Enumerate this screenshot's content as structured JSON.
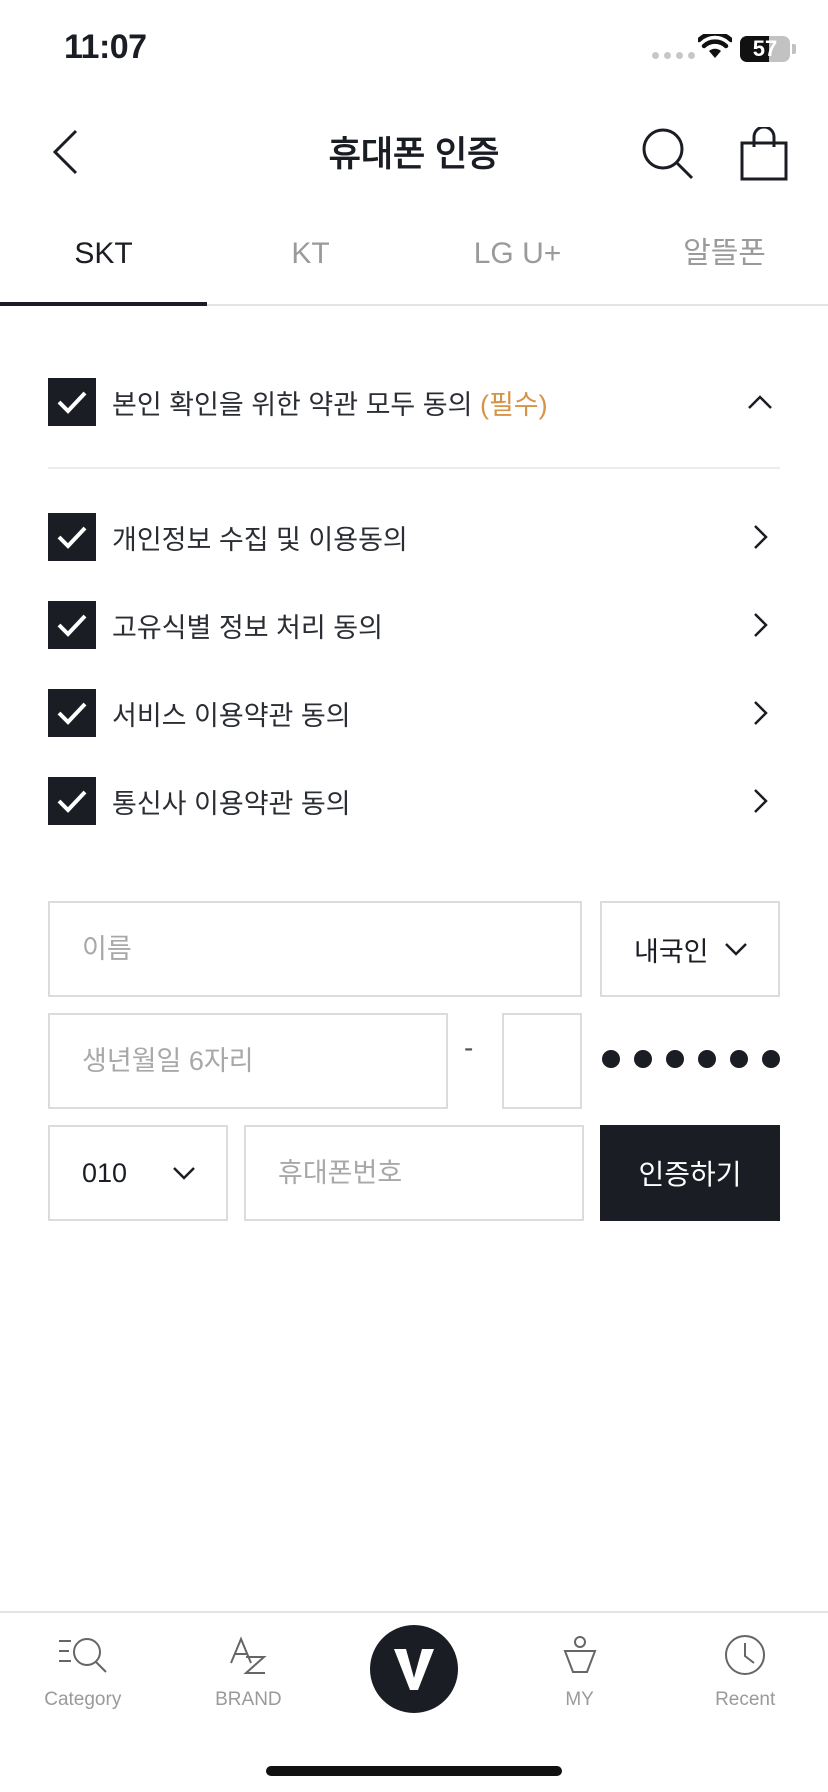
{
  "status_bar": {
    "time": "11:07",
    "battery": "57",
    "battery_level": 0.57
  },
  "header": {
    "title": "휴대폰 인증",
    "back_icon": "chevron-left-icon",
    "search_icon": "search-icon",
    "bag_icon": "shopping-bag-icon"
  },
  "tabs": [
    {
      "label": "SKT",
      "active": true
    },
    {
      "label": "KT",
      "active": false
    },
    {
      "label": "LG U+",
      "active": false
    },
    {
      "label": "알뜰폰",
      "active": false
    }
  ],
  "agreements": {
    "all": {
      "label": "본인 확인을 위한 약관 모두 동의",
      "required": "(필수)",
      "checked": true
    },
    "items": [
      {
        "label": "개인정보 수집 및 이용동의",
        "checked": true
      },
      {
        "label": "고유식별 정보 처리 동의",
        "checked": true
      },
      {
        "label": "서비스 이용약관 동의",
        "checked": true
      },
      {
        "label": "통신사 이용약관 동의",
        "checked": true
      }
    ]
  },
  "form": {
    "name_placeholder": "이름",
    "nationality": "내국인",
    "birth_placeholder": "생년월일 6자리",
    "separator": "-",
    "carrier_prefix": "010",
    "phone_placeholder": "휴대폰번호",
    "verify_button": "인증하기"
  },
  "bottom_nav": [
    {
      "label": "Category",
      "icon": "category-search-icon"
    },
    {
      "label": "BRAND",
      "icon": "az-icon"
    },
    {
      "label": "",
      "icon": "v-logo-icon"
    },
    {
      "label": "MY",
      "icon": "person-icon"
    },
    {
      "label": "Recent",
      "icon": "clock-icon"
    }
  ],
  "colors": {
    "primary": "#1a1d24",
    "required": "#d4944a",
    "muted": "#9a9a9a",
    "border": "#dcdcdc"
  }
}
